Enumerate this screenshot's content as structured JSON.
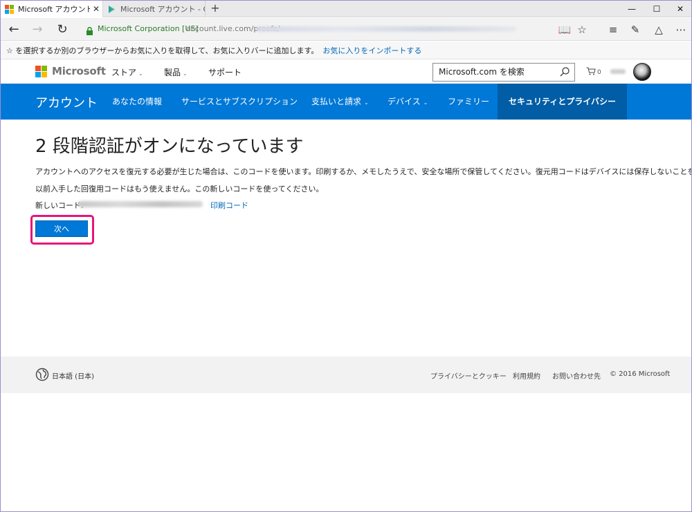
{
  "browser": {
    "tabs": [
      {
        "title": "Microsoft アカウント",
        "active": true
      },
      {
        "title": "Microsoft アカウント - Google",
        "active": false
      }
    ],
    "new_tab_label": "+",
    "window_controls": {
      "minimize": "—",
      "maximize": "☐",
      "close": "✕"
    },
    "address": {
      "site_identity": "Microsoft Corporation [US]",
      "url_visible": "account.live.com/proofs/"
    },
    "favorites_hint": {
      "text": "☆ を選択するか別のブラウザーからお気に入りを取得して、お気に入りバーに追加します。",
      "link": "お気に入りをインポートする"
    }
  },
  "site_header": {
    "brand": "Microsoft",
    "nav": [
      {
        "label": "ストア",
        "has_dropdown": true
      },
      {
        "label": "製品",
        "has_dropdown": true
      },
      {
        "label": "サポート",
        "has_dropdown": false
      }
    ],
    "search_placeholder": "Microsoft.com を検索",
    "cart_count": "0"
  },
  "account_nav": {
    "title": "アカウント",
    "items": [
      {
        "label": "あなたの情報",
        "has_dropdown": false
      },
      {
        "label": "サービスとサブスクリプション",
        "has_dropdown": false
      },
      {
        "label": "支払いと請求",
        "has_dropdown": true
      },
      {
        "label": "デバイス",
        "has_dropdown": true
      },
      {
        "label": "ファミリー",
        "has_dropdown": false
      },
      {
        "label": "セキュリティとプライバシー",
        "has_dropdown": false,
        "active": true
      }
    ]
  },
  "main": {
    "title": "2 段階認証がオンになっています",
    "paragraph1": "アカウントへのアクセスを復元する必要が生じた場合は、このコードを使います。印刷するか、メモしたうえで、安全な場所で保管してください。復元用コードはデバイスには保存しないことを強くお勧めします。",
    "paragraph2": "以前入手した回復用コードはもう使えません。この新しいコードを使ってください。",
    "code_label": "新しいコード:",
    "print_link": "印刷コード",
    "next_button": "次へ"
  },
  "footer": {
    "language": "日本語 (日本)",
    "links": [
      "プライバシーとクッキー",
      "利用規約",
      "お問い合わせ先",
      "© 2016 Microsoft"
    ]
  },
  "colors": {
    "accent_blue": "#0078d7",
    "active_nav": "#005da6",
    "highlight": "#e6147a",
    "link": "#0067b8"
  }
}
